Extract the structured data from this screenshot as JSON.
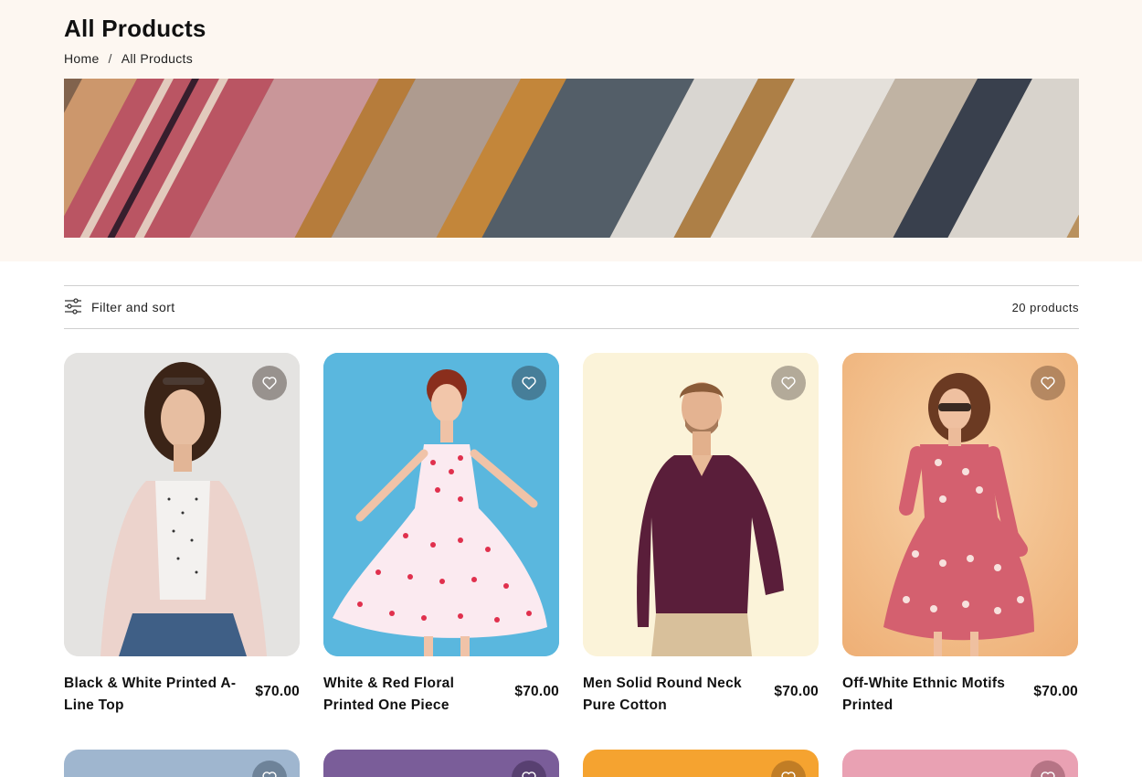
{
  "page": {
    "title": "All Products"
  },
  "breadcrumb": {
    "home": "Home",
    "separator": "/",
    "current": "All Products"
  },
  "toolbar": {
    "filter_label": "Filter and sort",
    "product_count": "20 products"
  },
  "colors": {
    "hero_bg": "#fdf7f1",
    "text": "#111111",
    "divider": "#cfcfcf"
  },
  "products": [
    {
      "name": "Black & White Printed A-Line Top",
      "price": "$70.00",
      "bg": "#e3e2e0"
    },
    {
      "name": "White & Red Floral Printed One Piece",
      "price": "$70.00",
      "bg": "#55b6dd"
    },
    {
      "name": "Men Solid Round Neck Pure Cotton",
      "price": "$70.00",
      "bg": "#fbf3d8"
    },
    {
      "name": "Off-White Ethnic Motifs Printed",
      "price": "$70.00",
      "bg": "#f3c089"
    }
  ],
  "products_row2": [
    {
      "bg": "#9fb6cf"
    },
    {
      "bg": "#7a5d99"
    },
    {
      "bg": "#f5a330"
    },
    {
      "bg": "#e9a1b3"
    }
  ],
  "icons": {
    "filter": "sliders-icon",
    "wishlist": "heart-icon"
  }
}
